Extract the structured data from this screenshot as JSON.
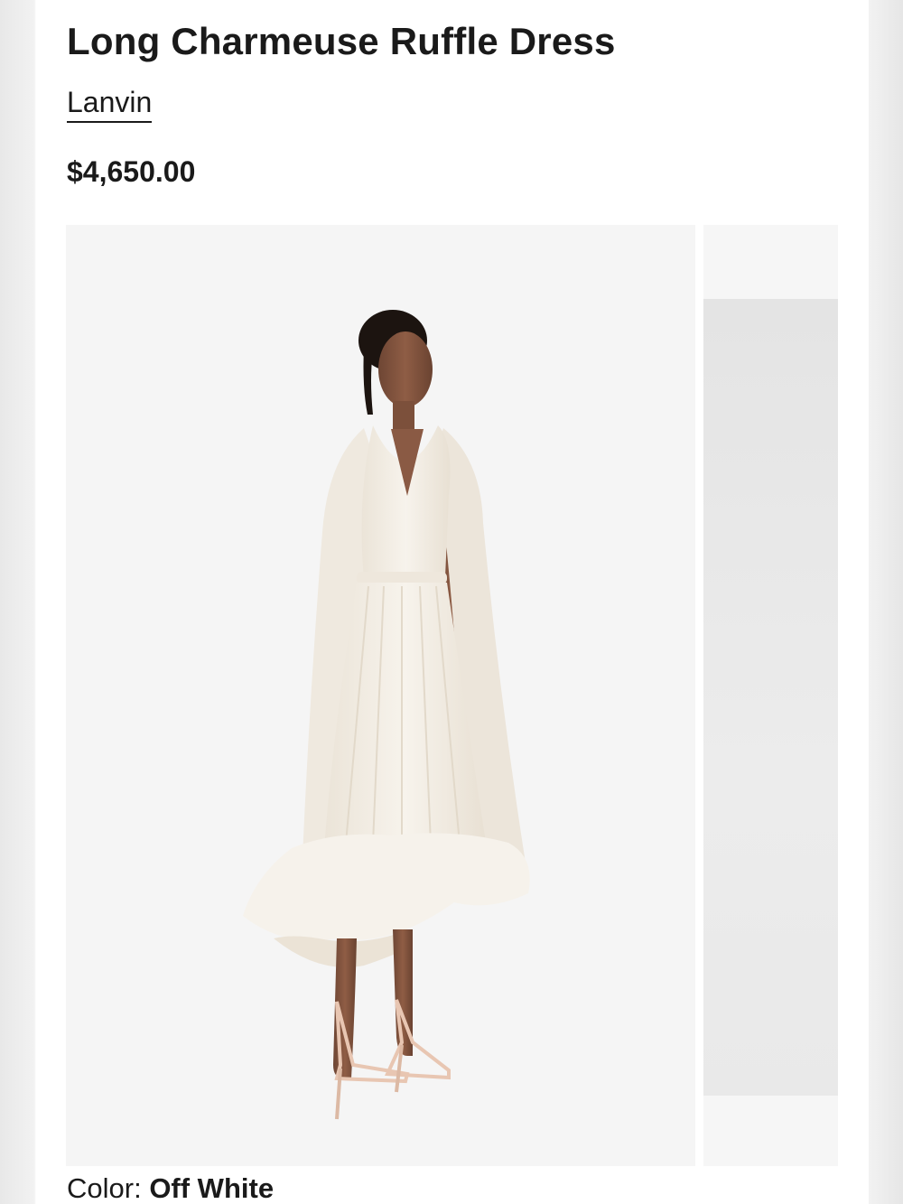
{
  "product": {
    "title": "Long Charmeuse Ruffle Dress",
    "brand": "Lanvin",
    "price": "$4,650.00"
  },
  "gallery": {
    "image_count_visible": 2
  },
  "color": {
    "label": "Color: ",
    "value": "Off White"
  },
  "colors": {
    "text": "#1a1a1a",
    "image_bg": "#f5f5f5",
    "dress": "#f4efe6",
    "skin": "#8a5a44"
  }
}
